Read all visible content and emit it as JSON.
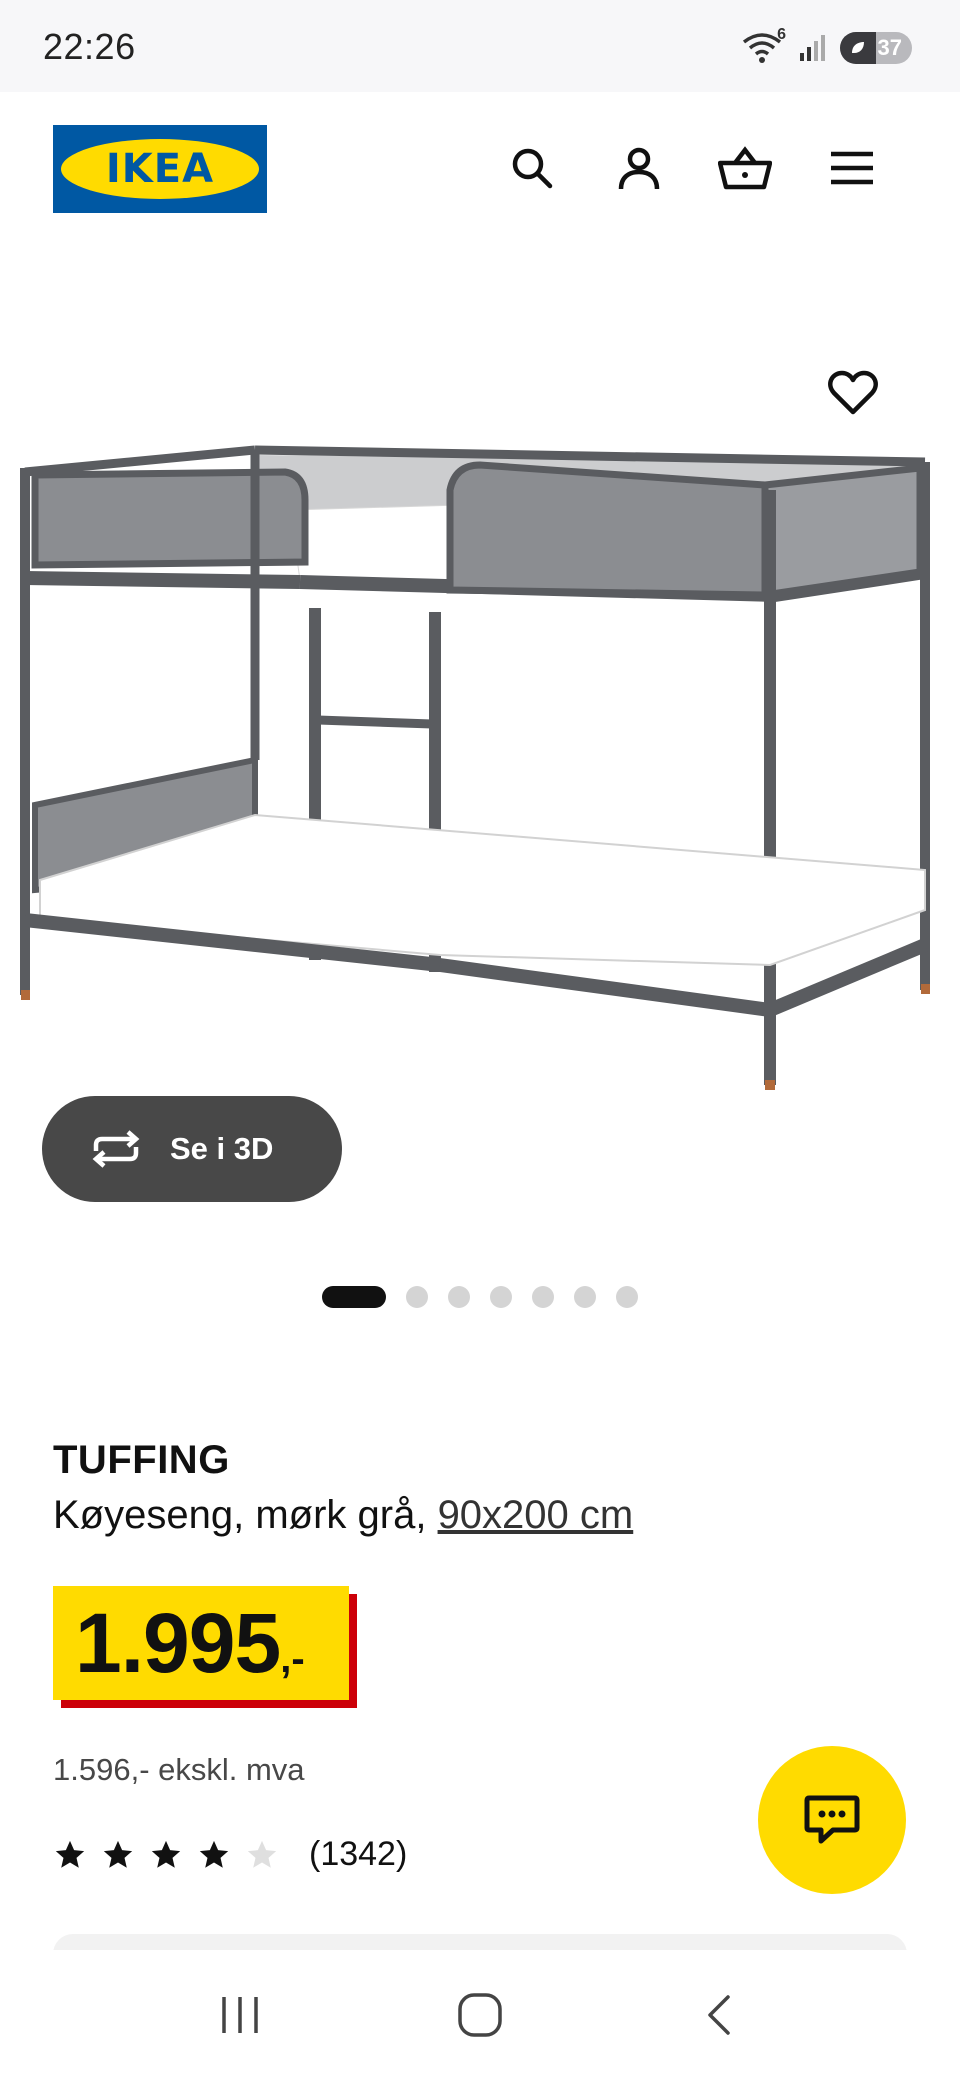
{
  "status_bar": {
    "time": "22:26",
    "wifi_badge": "6",
    "battery": "37"
  },
  "header": {
    "logo_text": "IKEA",
    "icons": [
      "search-icon",
      "account-icon",
      "basket-icon",
      "menu-icon"
    ]
  },
  "gallery": {
    "view_3d_label": "Se i 3D",
    "slide_count": 7,
    "active_slide": 1
  },
  "product": {
    "name": "TUFFING",
    "description": "Køyeseng, mørk grå, ",
    "size": "90x200 cm",
    "price_main": "1.995",
    "price_suffix": ",-",
    "price_excl_vat": "1.596,- ekskl. mva",
    "rating_value": 4,
    "rating_max": 5,
    "rating_count": "(1342)"
  },
  "colors": {
    "ikea_blue": "#0058a3",
    "ikea_yellow": "#ffdb00",
    "price_red": "#cc0008",
    "frame_gray": "#5a5c60"
  }
}
